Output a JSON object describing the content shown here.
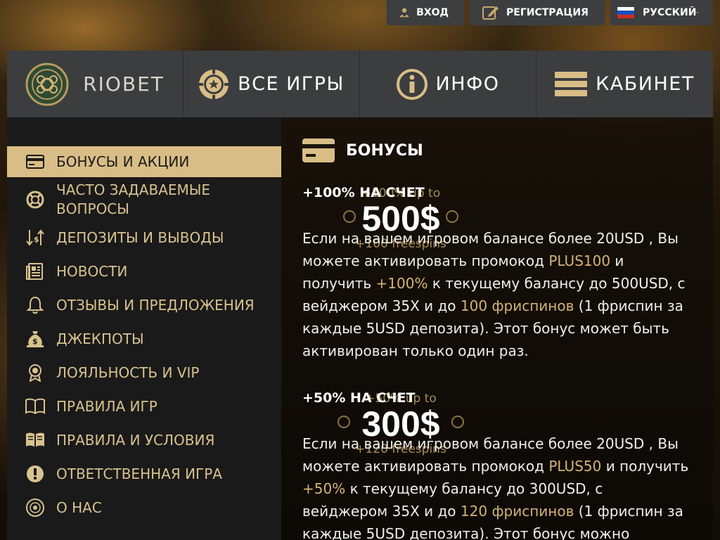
{
  "topbar": {
    "login": "ВХОД",
    "register": "РЕГИСТРАЦИЯ",
    "language": "РУССКИЙ"
  },
  "nav": {
    "logo": "RIOBET",
    "games": "ВСЕ ИГРЫ",
    "info": "ИНФО",
    "cabinet": "КАБИНЕТ"
  },
  "sidebar": {
    "items": [
      {
        "label": "БОНУСЫ И АКЦИИ",
        "icon": "card-icon"
      },
      {
        "label": "ЧАСТО ЗАДАВАЕМЫЕ ВОПРОСЫ",
        "icon": "lifebuoy-icon"
      },
      {
        "label": "ДЕПОЗИТЫ И ВЫВОДЫ",
        "icon": "sort-icon"
      },
      {
        "label": "НОВОСТИ",
        "icon": "news-icon"
      },
      {
        "label": "ОТЗЫВЫ И ПРЕДЛОЖЕНИЯ",
        "icon": "bell-icon"
      },
      {
        "label": "ДЖЕКПОТЫ",
        "icon": "money-bag-icon"
      },
      {
        "label": "ЛОЯЛЬНОСТЬ И VIP",
        "icon": "award-icon"
      },
      {
        "label": "ПРАВИЛА ИГР",
        "icon": "book-icon"
      },
      {
        "label": "ПРАВИЛА И УСЛОВИЯ",
        "icon": "book-open-icon"
      },
      {
        "label": "ОТВЕТСТВЕННАЯ ИГРА",
        "icon": "exclamation-icon"
      },
      {
        "label": "О НАС",
        "icon": "logo-icon"
      }
    ]
  },
  "content": {
    "title": "БОНУСЫ",
    "bonuses": [
      {
        "title": "+100% НА СЧЕТ",
        "promo_top": "+100% up to",
        "promo_amount": "500$",
        "promo_bottom": "+100 freespins",
        "text_1": "Если на вашем игровом балансе более 20USD , Вы можете активировать промокод ",
        "code": "PLUS100",
        "text_2": " и получить ",
        "percent": "+100%",
        "text_3": " к текущему балансу до 500USD, с вейджером 35X и до ",
        "spins": "100 фриспинов",
        "text_4": " (1 фриспин за каждые 5USD депозита). Этот бонус может быть активирован только один раз."
      },
      {
        "title": "+50% НА СЧЕТ",
        "promo_top": "+50% up to",
        "promo_amount": "300$",
        "promo_bottom": "+120 freespins",
        "text_1": "Если на вашем игровом балансе более 20USD , Вы можете активировать промокод ",
        "code": "PLUS50",
        "text_2": " и получить ",
        "percent": "+50%",
        "text_3": " к текущему балансу до 300USD, с вейджером 35X и до ",
        "spins": "120 фриспинов",
        "text_4": " (1 фриспин за каждые 5USD депозита). Этот бонус можно"
      }
    ]
  },
  "colors": {
    "accent": "#d9bd86",
    "menu_text": "#d8c28e",
    "highlight": "#d4b374",
    "panel": "#3b3d3f",
    "sidebar": "#1a1a1a"
  }
}
